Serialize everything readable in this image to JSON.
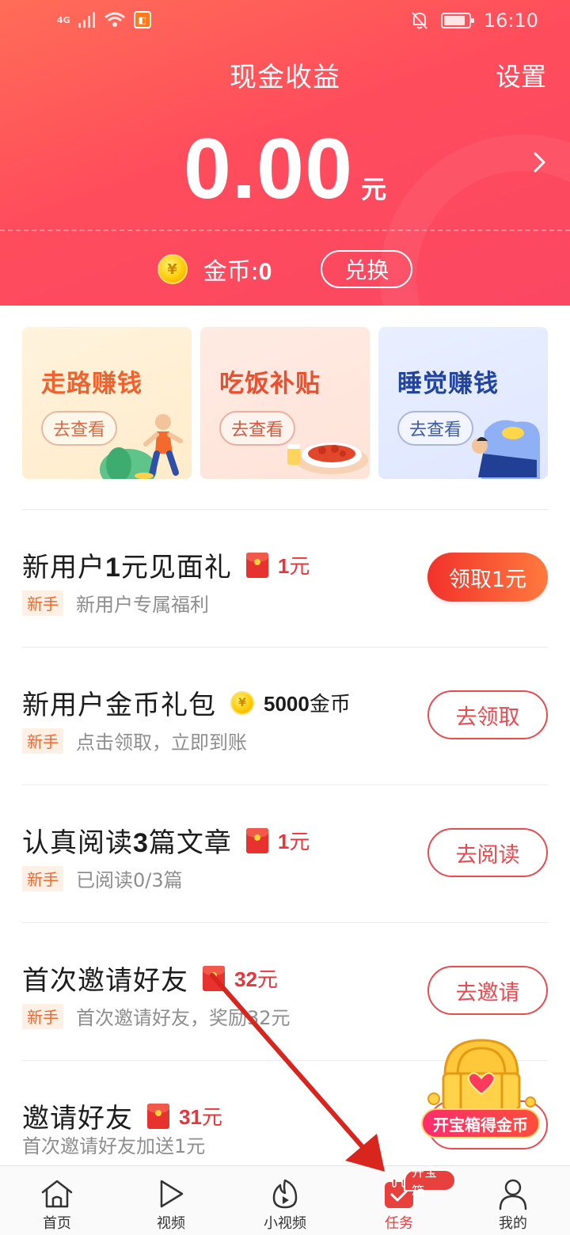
{
  "status_bar": {
    "network": "4G",
    "time": "16:10"
  },
  "header": {
    "title": "现金收益",
    "settings_label": "设置",
    "balance_amount": "0.00",
    "balance_unit": "元",
    "coin_label": "金币:",
    "coin_value": "0",
    "exchange_label": "兑换"
  },
  "cards": [
    {
      "title": "走路赚钱",
      "button": "去查看"
    },
    {
      "title": "吃饭补贴",
      "button": "去查看"
    },
    {
      "title": "睡觉赚钱",
      "button": "去查看"
    }
  ],
  "tasks": [
    {
      "title_a": "新用户",
      "title_num": "1",
      "title_b": "元见面礼",
      "reward_num": "1",
      "reward_unit": "元",
      "tag": "新手",
      "subtitle": "新用户专属福利",
      "button": "领取1元"
    },
    {
      "title": "新用户金币礼包",
      "reward_num": "5000",
      "reward_unit": "金币",
      "tag": "新手",
      "subtitle": "点击领取，立即到账",
      "button": "去领取"
    },
    {
      "title_a": "认真阅读",
      "title_num": "3",
      "title_b": "篇文章",
      "reward_num": "1",
      "reward_unit": "元",
      "tag": "新手",
      "subtitle": "已阅读0/3篇",
      "button": "去阅读"
    },
    {
      "title": "首次邀请好友",
      "reward_num": "32",
      "reward_unit": "元",
      "tag": "新手",
      "subtitle": "首次邀请好友，奖励32元",
      "button": "去邀请"
    },
    {
      "title": "邀请好友",
      "reward_num": "31",
      "reward_unit": "元",
      "subtitle": "首次邀请好友加送1元"
    }
  ],
  "treasure": {
    "label": "开宝箱得金币"
  },
  "bottom_nav": {
    "items": [
      {
        "label": "首页",
        "icon": "home-icon"
      },
      {
        "label": "视频",
        "icon": "play-icon"
      },
      {
        "label": "小视频",
        "icon": "small-video-icon"
      },
      {
        "label": "任务",
        "icon": "task-icon",
        "badge": "开宝箱"
      },
      {
        "label": "我的",
        "icon": "profile-icon"
      }
    ]
  },
  "colors": {
    "header": "#ff4c5c",
    "accent": "#e94b50",
    "tag": "#f26a2b"
  }
}
